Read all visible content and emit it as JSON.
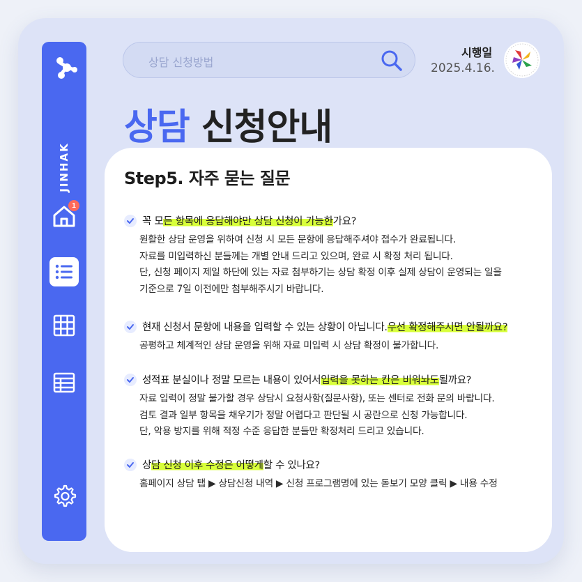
{
  "sidebar": {
    "brand": "JINHAK",
    "home_badge": "1",
    "icons": [
      "network-logo-icon",
      "home-icon",
      "list-icon",
      "grid-icon",
      "table-icon",
      "gear-icon"
    ]
  },
  "search": {
    "text": "상담 신청방법",
    "icon": "search-icon"
  },
  "header": {
    "date_label": "시행일",
    "date_value": "2025.4.16."
  },
  "title": {
    "accent": "상담",
    "main": "신청안내"
  },
  "card": {
    "step_title": "Step5. 자주 묻는 질문",
    "items": [
      {
        "q_pre": "꼭 모",
        "q_hl": "든 항목에 응답해야만 상담 신청이 가능한",
        "q_post": "가요?",
        "answers": [
          "원활한 상담 운영을 위하여 신청 시 모든 문항에 응답해주셔야 접수가 완료됩니다.",
          "자료를 미입력하신 분들께는 개별 안내 드리고 있으며, 완료 시 확정 처리 됩니다.",
          "단, 신청 페이지 제일 하단에 있는 자료 첨부하기는 상담 확정 이후 실제 상담이 운영되는 일을",
          "기준으로 7일 이전에만 첨부해주시기 바랍니다."
        ]
      },
      {
        "q_pre": "현재 신청서 문항에 내용을 입력할 수 있는 상황이 아닙니다. ",
        "q_hl": "우선 확정해주시면 안될까요?",
        "q_post": "",
        "answers": [
          "공평하고 체계적인 상담 운영을 위해 자료 미입력 시 상담 확정이 불가합니다."
        ]
      },
      {
        "q_pre": "성적표 분실이나 정말 모르는 내용이 있어서 ",
        "q_hl": "입력을 못하는 칸은 비워놔도 ",
        "q_post": "될까요?",
        "answers": [
          "자료 입력이 정말 불가할 경우 상담시 요청사항(질문사항), 또는 센터로 전화 문의 바랍니다.",
          "검토 결과 일부 항목을 채우기가 정말 어렵다고 판단될 시 공란으로 신청 가능합니다.",
          "단, 악용 방지를 위해 적정 수준 응답한 분들만 확정처리 드리고 있습니다."
        ]
      },
      {
        "q_pre": "상",
        "q_hl": "담 신청 이후 수정은 어떻게 ",
        "q_post": "할 수 있나요?",
        "answers": [
          "홈페이지 상담 탭 ▶ 상담신청 내역 ▶ 신청 프로그램명에 있는 돋보기 모양 클릭 ▶ 내용 수정"
        ]
      }
    ]
  },
  "colors": {
    "accent": "#4a68f0",
    "highlight": "#d8ff3a",
    "frame": "#dde3f7"
  }
}
